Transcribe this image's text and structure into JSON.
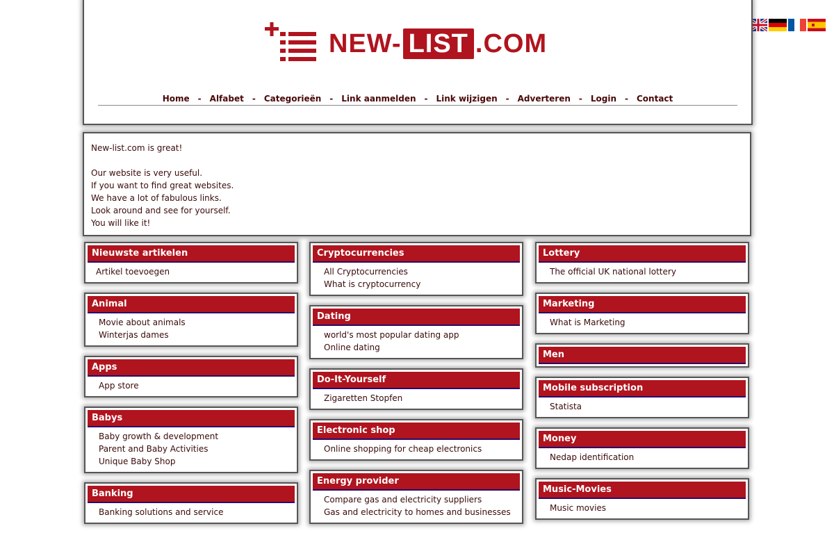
{
  "brand": {
    "logo_prefix": "NEW-",
    "logo_box": "LIST",
    "logo_suffix": ".COM",
    "accent": "#b0141e",
    "logo_icon": "list-plus-icon"
  },
  "languages": [
    {
      "code": "en",
      "icon": "uk-flag-icon"
    },
    {
      "code": "de",
      "icon": "german-flag-icon"
    },
    {
      "code": "fr",
      "icon": "french-flag-icon"
    },
    {
      "code": "es",
      "icon": "spanish-flag-icon"
    }
  ],
  "nav": [
    "Home",
    "Alfabet",
    "Categorieën",
    "Link aanmelden",
    "Link wijzigen",
    "Adverteren",
    "Login",
    "Contact"
  ],
  "nav_separator": "-",
  "intro": [
    "New-list.com is great!",
    "",
    "Our website is very useful.",
    "If you want to find great websites.",
    "We have a lot of fabulous links.",
    "Look around and see for yourself.",
    "You will like it!"
  ],
  "columns": [
    [
      {
        "title": "Nieuwste artikelen",
        "links": [
          "Artikel toevoegen"
        ]
      },
      {
        "title": "Animal",
        "links": [
          "Movie about animals",
          "Winterjas dames"
        ]
      },
      {
        "title": "Apps",
        "links": [
          "App store"
        ]
      },
      {
        "title": "Babys",
        "links": [
          "Baby growth & development",
          "Parent and Baby Activities",
          "Unique Baby Shop"
        ]
      },
      {
        "title": "Banking",
        "links": [
          "Banking solutions and service"
        ]
      }
    ],
    [
      {
        "title": "Cryptocurrencies",
        "links": [
          "All Cryptocurrencies",
          "What is cryptocurrency"
        ]
      },
      {
        "title": "Dating",
        "links": [
          "world's most popular dating app",
          "Online dating"
        ]
      },
      {
        "title": "Do-It-Yourself",
        "links": [
          "Zigaretten Stopfen"
        ]
      },
      {
        "title": "Electronic shop",
        "links": [
          "Online shopping for cheap electronics"
        ]
      },
      {
        "title": "Energy provider",
        "links": [
          "Compare gas and electricity suppliers",
          "Gas and electricity to homes and businesses"
        ]
      }
    ],
    [
      {
        "title": "Lottery",
        "links": [
          "The official UK national lottery"
        ]
      },
      {
        "title": "Marketing",
        "links": [
          "What is Marketing"
        ]
      },
      {
        "title": "Men",
        "links": []
      },
      {
        "title": "Mobile subscription",
        "links": [
          "Statista"
        ]
      },
      {
        "title": "Money",
        "links": [
          "Nedap identification"
        ]
      },
      {
        "title": "Music-Movies",
        "links": [
          "Music movies"
        ]
      }
    ]
  ]
}
